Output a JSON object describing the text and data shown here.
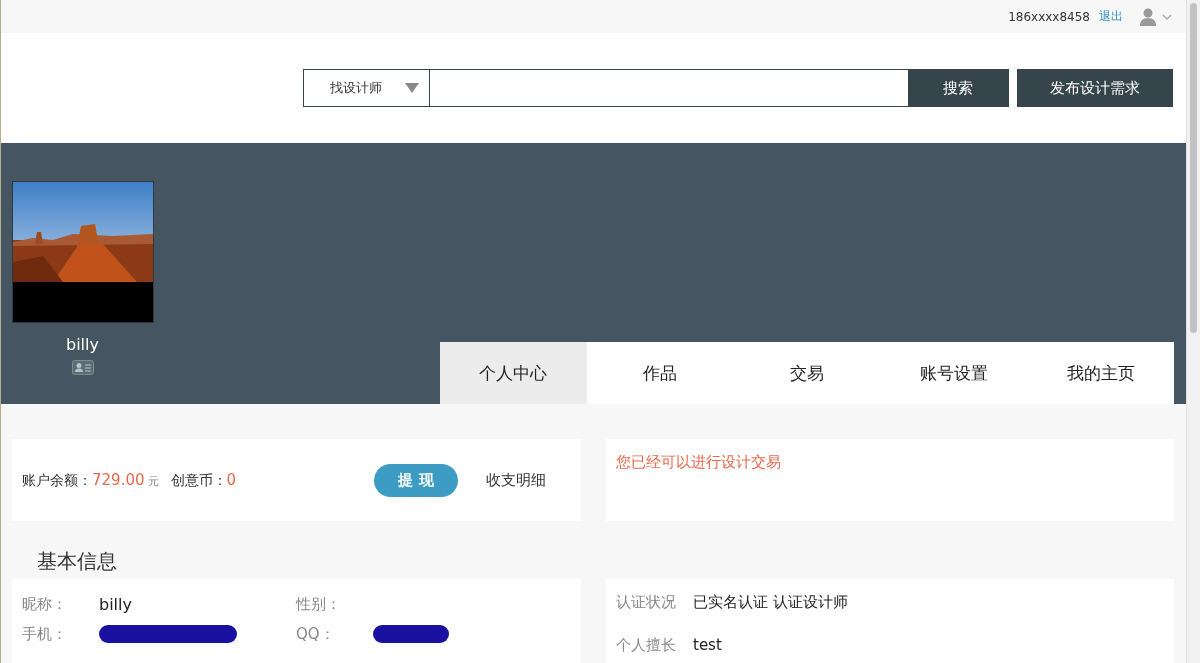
{
  "top_bar": {
    "phone": "186xxxx8458",
    "logout": "退出"
  },
  "search": {
    "category": "找设计师",
    "search_button": "搜索",
    "publish_button": "发布设计需求"
  },
  "profile": {
    "name": "billy"
  },
  "tabs": [
    {
      "label": "个人中心",
      "selected": true
    },
    {
      "label": "作品",
      "selected": false
    },
    {
      "label": "交易",
      "selected": false
    },
    {
      "label": "账号设置",
      "selected": false
    },
    {
      "label": "我的主页",
      "selected": false
    }
  ],
  "account": {
    "balance_label": "账户余额：",
    "balance": "729.00",
    "unit": "元",
    "coins_label": "创意币：",
    "coins": "0",
    "withdraw_button": "提 现",
    "details_link": "收支明细"
  },
  "notice": "您已经可以进行设计交易",
  "basic_info": {
    "title": "基本信息",
    "fields": [
      {
        "label": "昵称：",
        "value": "billy",
        "kind": "text"
      },
      {
        "label": "性别：",
        "kind": "text"
      },
      {
        "label": "手机：",
        "kind": "redacted"
      },
      {
        "label": "QQ：",
        "kind": "redacted"
      }
    ]
  },
  "certification": [
    {
      "label": "认证状况",
      "value": "已实名认证 认证设计师"
    },
    {
      "label": "个人擅长",
      "value": "test"
    }
  ]
}
